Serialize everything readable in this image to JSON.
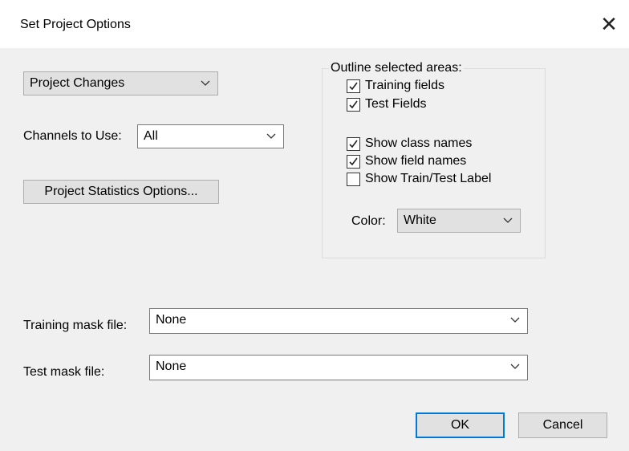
{
  "window": {
    "title": "Set Project Options",
    "close_glyph": "✕"
  },
  "project_changes": {
    "value": "Project Changes"
  },
  "channels": {
    "label": "Channels to Use:",
    "value": "All"
  },
  "stats_button": {
    "label": "Project Statistics Options..."
  },
  "outline": {
    "caption": "Outline selected areas:",
    "training_fields": {
      "label": "Training fields",
      "checked": true
    },
    "test_fields": {
      "label": "Test Fields",
      "checked": true
    },
    "show_class_names": {
      "label": "Show class names",
      "checked": true
    },
    "show_field_names": {
      "label": "Show field names",
      "checked": true
    },
    "show_train_test_label": {
      "label": "Show Train/Test Label",
      "checked": false
    },
    "color": {
      "label": "Color:",
      "value": "White"
    }
  },
  "training_mask": {
    "label": "Training mask file:",
    "value": "None"
  },
  "test_mask": {
    "label": "Test mask file:",
    "value": "None"
  },
  "buttons": {
    "ok": "OK",
    "cancel": "Cancel"
  },
  "icons": {
    "close": "close-icon",
    "dropdown": "chevron-down-icon",
    "check": "checkmark-icon"
  }
}
